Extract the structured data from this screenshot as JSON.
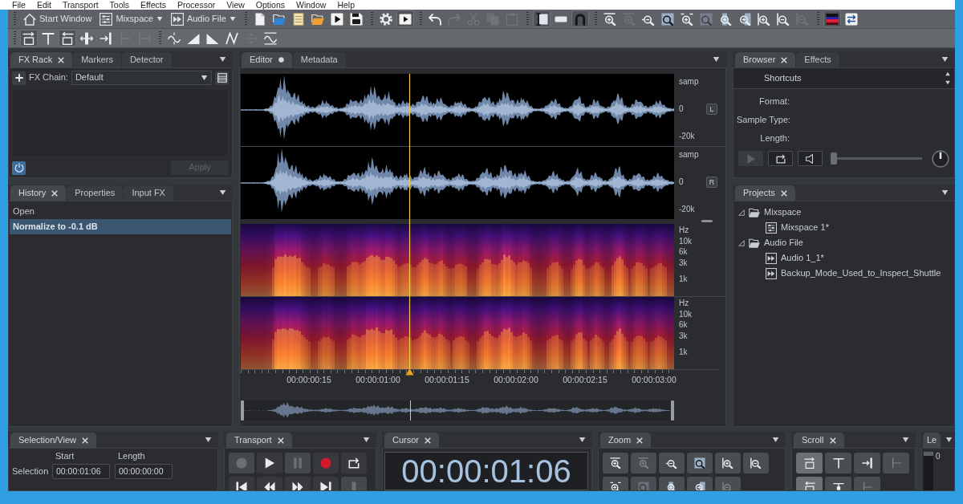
{
  "menu_bar": {
    "items": [
      "File",
      "Edit",
      "Transport",
      "Tools",
      "Effects",
      "Processor",
      "View",
      "Options",
      "Window",
      "Help"
    ]
  },
  "toolbar_1": {
    "groups": [
      [
        {
          "label": "Start Window",
          "dropdown": false
        },
        {
          "label": "Mixspace",
          "dropdown": true
        },
        {
          "label": "Audio File",
          "dropdown": true
        }
      ],
      [
        {
          "active": false,
          "disabled": false
        },
        {
          "active": false,
          "disabled": false
        },
        {
          "active": false,
          "disabled": false
        },
        {
          "active": false,
          "disabled": false
        },
        {
          "active": false,
          "disabled": false
        },
        {
          "active": false,
          "disabled": false
        }
      ],
      [
        {
          "active": false,
          "disabled": false
        },
        {
          "active": true,
          "disabled": false
        }
      ],
      [
        {
          "active": false,
          "disabled": false
        },
        {
          "active": false,
          "disabled": true
        },
        {
          "active": false,
          "disabled": true
        },
        {
          "active": false,
          "disabled": true
        },
        {
          "active": false,
          "disabled": true
        }
      ],
      [
        {
          "active": true,
          "disabled": false
        },
        {
          "active": false,
          "disabled": false
        },
        {
          "active": true,
          "disabled": false
        }
      ],
      [
        {
          "active": false,
          "disabled": false
        },
        {
          "active": false,
          "disabled": true
        },
        {
          "active": false,
          "disabled": false
        },
        {
          "active": false,
          "disabled": false
        },
        {
          "active": false,
          "disabled": false
        },
        {
          "active": false,
          "disabled": true
        },
        {
          "active": false,
          "disabled": false
        },
        {
          "active": false,
          "disabled": false
        },
        {
          "active": false,
          "disabled": false
        },
        {
          "active": false,
          "disabled": false
        },
        {
          "active": false,
          "disabled": true
        }
      ],
      [
        {
          "active": true,
          "disabled": false
        },
        {
          "active": false,
          "disabled": false
        }
      ]
    ]
  },
  "toolbar_2": {
    "groups": [
      [
        {
          "active": true,
          "disabled": false
        },
        {
          "active": false,
          "disabled": false
        },
        {
          "active": true,
          "disabled": false
        },
        {
          "active": false,
          "disabled": false
        },
        {
          "active": false,
          "disabled": false
        },
        {
          "active": false,
          "disabled": true
        },
        {
          "active": false,
          "disabled": true
        }
      ],
      [
        {
          "active": false,
          "disabled": false
        },
        {
          "active": false,
          "disabled": false
        },
        {
          "active": false,
          "disabled": false
        },
        {
          "active": false,
          "disabled": false
        },
        {
          "active": false,
          "disabled": true
        },
        {
          "active": false,
          "disabled": false
        }
      ]
    ]
  },
  "fx_rack": {
    "tabs": [
      {
        "label": "FX Rack",
        "selected": true,
        "close_button": true
      },
      {
        "label": "Markers",
        "selected": false,
        "close_button": false
      },
      {
        "label": "Detector",
        "selected": false,
        "close_button": false
      }
    ],
    "chain_label": "FX Chain:",
    "chain_value": "Default",
    "power_on": true,
    "apply": {
      "label": "Apply",
      "disabled": true
    }
  },
  "history": {
    "tabs": [
      {
        "label": "History",
        "selected": true,
        "close_button": true
      },
      {
        "label": "Properties",
        "selected": false,
        "close_button": false
      },
      {
        "label": "Input FX",
        "selected": false,
        "close_button": false
      }
    ],
    "items": [
      {
        "label": "Open",
        "selected": false
      },
      {
        "label": "Normalize to -0.1 dB",
        "selected": true
      }
    ]
  },
  "editor": {
    "tabs": [
      {
        "label": "Editor",
        "selected": true,
        "close_button": false,
        "modified": true
      },
      {
        "label": "Metadata",
        "selected": false,
        "close_button": false,
        "modified": false
      }
    ],
    "waveform_channels": [
      {
        "scale": [
          "samp",
          "0",
          "-20k"
        ],
        "channel_button": "L"
      },
      {
        "scale": [
          "samp",
          "0",
          "-20k"
        ],
        "channel_button": "R"
      }
    ],
    "spectrogram_channels": [
      {
        "scale": [
          "Hz",
          "10k",
          "6k",
          "3k",
          "1k"
        ]
      },
      {
        "scale": [
          "Hz",
          "10k",
          "6k",
          "3k",
          "1k"
        ]
      }
    ],
    "playhead": {
      "level": 0.39
    },
    "timeline": [
      "00:00:00:15",
      "00:00:01:00",
      "00:00:01:15",
      "00:00:02:00",
      "00:00:02:15",
      "00:00:03:00"
    ]
  },
  "browser": {
    "tabs": [
      {
        "label": "Browser",
        "selected": true,
        "close_button": true
      },
      {
        "label": "Effects",
        "selected": false,
        "close_button": false
      }
    ],
    "location": "Shortcuts",
    "field_labels": [
      "Format:",
      "Sample Type:",
      "Length:"
    ],
    "preview_buttons": [
      {
        "disabled": true
      },
      {
        "disabled": false
      },
      {
        "disabled": false
      }
    ],
    "slider": {
      "level": 0
    }
  },
  "projects": {
    "tabs": [
      {
        "label": "Projects",
        "selected": true,
        "close_button": true
      }
    ],
    "tree": [
      {
        "label": "Mixspace",
        "kind": "folder",
        "expanded": true,
        "children": [
          {
            "label": "Mixspace 1*",
            "kind": "mixspace"
          }
        ]
      },
      {
        "label": "Audio File",
        "kind": "folder",
        "expanded": true,
        "children": [
          {
            "label": "Audio 1_1*",
            "kind": "audio"
          },
          {
            "label": "Backup_Mode_Used_to_Inspect_Shuttle",
            "kind": "audio"
          }
        ]
      }
    ]
  },
  "selection_view": {
    "tabs": [
      {
        "label": "Selection/View",
        "selected": true,
        "close_button": true
      }
    ],
    "columns": [
      "Start",
      "Length"
    ],
    "rows": [
      {
        "label": "Selection",
        "values": [
          "00:00:01:06",
          "00:00:00:00"
        ]
      }
    ]
  },
  "transport": {
    "tabs": [
      {
        "label": "Transport",
        "selected": true,
        "close_button": true
      }
    ],
    "buttons": [
      [
        {
          "disabled": true
        },
        {
          "disabled": false
        },
        {
          "disabled": true
        },
        {
          "disabled": false
        },
        {
          "disabled": false
        }
      ],
      [
        {
          "disabled": false
        },
        {
          "disabled": false
        },
        {
          "disabled": false
        },
        {
          "disabled": false
        },
        {
          "disabled": true
        }
      ]
    ]
  },
  "cursor": {
    "tabs": [
      {
        "label": "Cursor",
        "selected": true,
        "close_button": true
      }
    ],
    "time": "00:00:01:06"
  },
  "zoom": {
    "tabs": [
      {
        "label": "Zoom",
        "selected": true,
        "close_button": true
      }
    ],
    "buttons": [
      [
        {
          "disabled": false
        },
        {
          "disabled": true
        },
        {
          "disabled": false
        },
        {
          "disabled": false
        },
        {
          "disabled": false
        },
        {
          "disabled": false
        }
      ],
      [
        {
          "disabled": false
        },
        {
          "disabled": true
        },
        {
          "disabled": false
        },
        {
          "disabled": false
        },
        {
          "disabled": true
        }
      ]
    ]
  },
  "scroll": {
    "tabs": [
      {
        "label": "Scroll",
        "selected": true,
        "close_button": true
      }
    ],
    "buttons": [
      [
        {
          "active": true,
          "disabled": false
        },
        {
          "active": false,
          "disabled": false
        },
        {
          "active": false,
          "disabled": false
        },
        {
          "active": false,
          "disabled": true
        }
      ],
      [
        {
          "active": true,
          "disabled": false
        },
        {
          "active": false,
          "disabled": false
        },
        {
          "active": false,
          "disabled": true
        }
      ]
    ]
  },
  "level": {
    "tabs": [
      {
        "label": "Le",
        "selected": true,
        "close_button": false
      }
    ],
    "scale": [
      "0"
    ]
  }
}
